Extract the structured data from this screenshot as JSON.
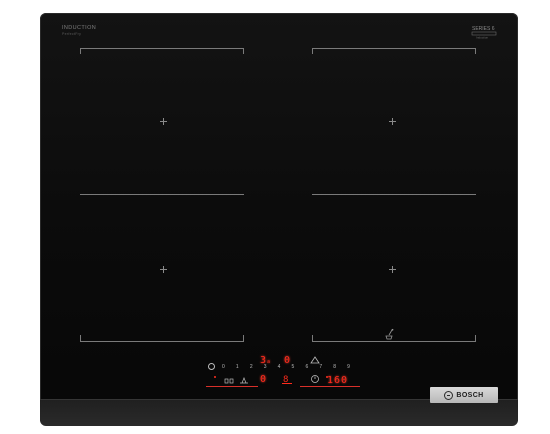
{
  "product": {
    "type_label": "INDUCTION",
    "sub_label": "PerfectFry",
    "top_right_badge": "SERIES 6",
    "top_right_sub": "Induction",
    "brand": "BOSCH"
  },
  "display": {
    "left_upper_digit": "3",
    "left_upper_small": "a",
    "right_upper_digit": "0",
    "left_lower_digit": "0",
    "timer_value": "160",
    "led_color": "#ff2b1c"
  },
  "controls": {
    "power_scale": [
      "0",
      "1",
      "2",
      "3",
      "4",
      "5",
      "6",
      "7",
      "8",
      "9"
    ],
    "icons": [
      "power-icon",
      "lock-icon",
      "pan-icon",
      "timer-icon",
      "flex-icon",
      "cook-icon"
    ]
  },
  "colors": {
    "glass": "#0b0b0b",
    "frame": "#2a2a2a",
    "zone_marks": "#7a7a7a"
  }
}
